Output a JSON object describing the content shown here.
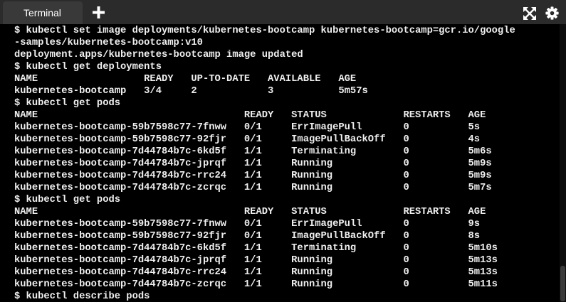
{
  "tabs": [
    {
      "label": "Terminal"
    }
  ],
  "icons": {
    "new_tab": "plus-icon",
    "fullscreen": "fullscreen-icon",
    "settings": "gear-icon"
  },
  "colors": {
    "tabbar_bg": "#2b2b2b",
    "tab_active_bg": "#393939",
    "terminal_bg": "#000000",
    "terminal_fg": "#efefef"
  },
  "terminal": {
    "lines": [
      "$ kubectl set image deployments/kubernetes-bootcamp kubernetes-bootcamp=gcr.io/google",
      "-samples/kubernetes-bootcamp:v10",
      "deployment.apps/kubernetes-bootcamp image updated",
      "$ kubectl get deployments",
      "NAME                  READY   UP-TO-DATE   AVAILABLE   AGE",
      "kubernetes-bootcamp   3/4     2            3           5m57s",
      "$ kubectl get pods",
      "NAME                                   READY   STATUS             RESTARTS   AGE",
      "kubernetes-bootcamp-59b7598c77-7fnww   0/1     ErrImagePull       0          5s",
      "kubernetes-bootcamp-59b7598c77-92fjr   0/1     ImagePullBackOff   0          4s",
      "kubernetes-bootcamp-7d44784b7c-6kd5f   1/1     Terminating        0          5m6s",
      "kubernetes-bootcamp-7d44784b7c-jprqf   1/1     Running            0          5m9s",
      "kubernetes-bootcamp-7d44784b7c-rrc24   1/1     Running            0          5m9s",
      "kubernetes-bootcamp-7d44784b7c-zcrqc   1/1     Running            0          5m7s",
      "$ kubectl get pods",
      "NAME                                   READY   STATUS             RESTARTS   AGE",
      "kubernetes-bootcamp-59b7598c77-7fnww   0/1     ErrImagePull       0          9s",
      "kubernetes-bootcamp-59b7598c77-92fjr   0/1     ImagePullBackOff   0          8s",
      "kubernetes-bootcamp-7d44784b7c-6kd5f   1/1     Terminating        0          5m10s",
      "kubernetes-bootcamp-7d44784b7c-jprqf   1/1     Running            0          5m13s",
      "kubernetes-bootcamp-7d44784b7c-rrc24   1/1     Running            0          5m13s",
      "kubernetes-bootcamp-7d44784b7c-zcrqc   1/1     Running            0          5m11s",
      "$ kubectl describe pods"
    ]
  }
}
